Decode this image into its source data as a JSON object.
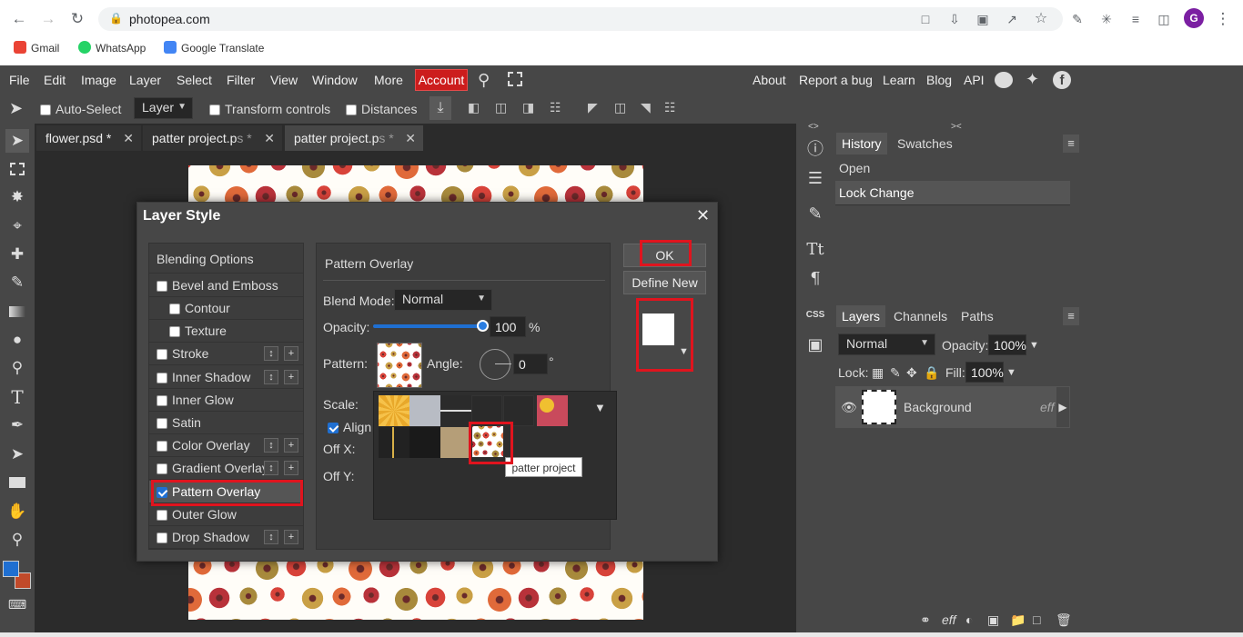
{
  "browser": {
    "url": "photopea.com",
    "bookmarks": [
      "Gmail",
      "WhatsApp",
      "Google Translate"
    ],
    "avatar_letter": "G"
  },
  "menu": {
    "items": [
      "File",
      "Edit",
      "Image",
      "Layer",
      "Select",
      "Filter",
      "View",
      "Window",
      "More"
    ],
    "account": "Account",
    "right_links": [
      "About",
      "Report a bug",
      "Learn",
      "Blog",
      "API"
    ]
  },
  "tool_options": {
    "auto_select": "Auto-Select",
    "layer_select": "Layer",
    "transform_controls": "Transform controls",
    "distances": "Distances"
  },
  "doc_tabs": [
    {
      "label": "flower.psd *"
    },
    {
      "label": "patter project.p"
    },
    {
      "label": "patter project.p"
    }
  ],
  "doc_tab_suffix": "s *",
  "right_panel": {
    "tabs_top": [
      "History",
      "Swatches"
    ],
    "history": [
      "Open",
      "Lock Change"
    ],
    "tabs_bottom": [
      "Layers",
      "Channels",
      "Paths"
    ],
    "blend": "Normal",
    "opacity_label": "Opacity:",
    "opacity_value": "100%",
    "lock_label": "Lock:",
    "fill_label": "Fill:",
    "fill_value": "100%",
    "layer_name": "Background",
    "layer_fx": "eff",
    "css_label": "CSS"
  },
  "dialog": {
    "title": "Layer Style",
    "styles": [
      {
        "label": "Blending Options"
      },
      {
        "label": "Bevel and Emboss"
      },
      {
        "label": "Contour"
      },
      {
        "label": "Texture"
      },
      {
        "label": "Stroke"
      },
      {
        "label": "Inner Shadow"
      },
      {
        "label": "Inner Glow"
      },
      {
        "label": "Satin"
      },
      {
        "label": "Color Overlay"
      },
      {
        "label": "Gradient Overlay"
      },
      {
        "label": "Pattern Overlay"
      },
      {
        "label": "Outer Glow"
      },
      {
        "label": "Drop Shadow"
      }
    ],
    "section_title": "Pattern Overlay",
    "blend_mode_label": "Blend Mode:",
    "blend_mode_value": "Normal",
    "opacity_label": "Opacity:",
    "opacity_value": "100",
    "opacity_unit": "%",
    "pattern_label": "Pattern:",
    "angle_label": "Angle:",
    "angle_value": "0",
    "angle_unit": "°",
    "scale_label": "Scale:",
    "align_label": "Align",
    "offx_label": "Off X:",
    "offy_label": "Off Y:",
    "tooltip": "patter project",
    "ok_label": "OK",
    "define_new_label": "Define New"
  },
  "colors": {
    "accent": "#1f6fd1",
    "account_bg": "#cc1d1d",
    "highlight": "#e0141e",
    "foreground": "#1f6fd1",
    "background": "#c14a2a"
  }
}
